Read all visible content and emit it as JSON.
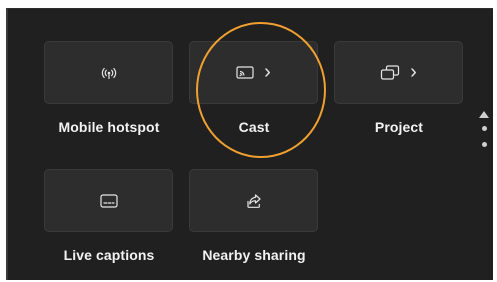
{
  "tiles": [
    {
      "label": "Mobile hotspot",
      "icon": "mobile-hotspot-icon",
      "chevron": false
    },
    {
      "label": "Cast",
      "icon": "cast-icon",
      "chevron": true
    },
    {
      "label": "Project",
      "icon": "project-icon",
      "chevron": true
    },
    {
      "label": "Live captions",
      "icon": "live-captions-icon",
      "chevron": false
    },
    {
      "label": "Nearby sharing",
      "icon": "nearby-sharing-icon",
      "chevron": false
    }
  ],
  "chevron_glyph": "›",
  "colors": {
    "panel_bg": "#202020",
    "tile_bg": "#2d2d2d",
    "text": "#f2f2f2",
    "highlight": "#f0a030"
  }
}
